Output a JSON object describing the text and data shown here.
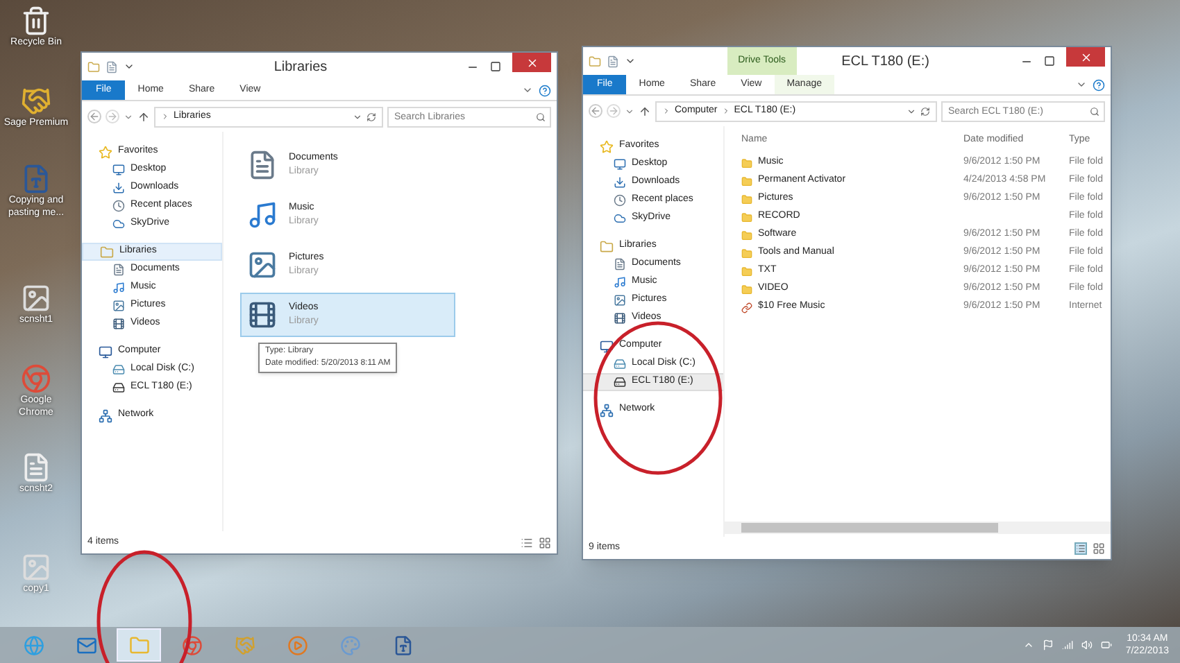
{
  "desktop_icons": [
    {
      "label": "Recycle Bin",
      "kind": "bin"
    },
    {
      "label": "Sage Premium",
      "kind": "app"
    },
    {
      "label": "Copying and pasting me...",
      "kind": "word"
    },
    {
      "label": "scnsht1",
      "kind": "image"
    },
    {
      "label": "Google Chrome",
      "kind": "chrome"
    },
    {
      "label": "scnsht2",
      "kind": "doc"
    },
    {
      "label": "copy1",
      "kind": "image"
    }
  ],
  "windows": [
    {
      "kind": "libraries",
      "title": "Libraries",
      "tabs": [
        {
          "label": "File",
          "kind": "file"
        },
        {
          "label": "Home",
          "kind": "tab"
        },
        {
          "label": "Share",
          "kind": "tab"
        },
        {
          "label": "View",
          "kind": "tab"
        }
      ],
      "address": [
        "Libraries"
      ],
      "search": {
        "placeholder": "Search Libraries"
      },
      "nav": [
        {
          "label": "Favorites",
          "selected": false,
          "children": [
            {
              "label": "Desktop",
              "selected": false
            },
            {
              "label": "Downloads",
              "selected": false
            },
            {
              "label": "Recent places",
              "selected": false
            },
            {
              "label": "SkyDrive",
              "selected": false
            }
          ]
        },
        {
          "label": "Libraries",
          "selected": true,
          "children": [
            {
              "label": "Documents",
              "selected": false
            },
            {
              "label": "Music",
              "selected": false
            },
            {
              "label": "Pictures",
              "selected": false
            },
            {
              "label": "Videos",
              "selected": false
            }
          ]
        },
        {
          "label": "Computer",
          "selected": false,
          "children": [
            {
              "label": "Local Disk (C:)",
              "selected": false
            },
            {
              "label": "ECL T180 (E:)",
              "selected": false
            }
          ]
        },
        {
          "label": "Network",
          "selected": false
        }
      ],
      "tiles": [
        {
          "name": "Documents",
          "subtitle": "Library",
          "selected": false
        },
        {
          "name": "Music",
          "subtitle": "Library",
          "selected": false
        },
        {
          "name": "Pictures",
          "subtitle": "Library",
          "selected": false
        },
        {
          "name": "Videos",
          "subtitle": "Library",
          "selected": true
        }
      ],
      "tooltip": [
        "Type: Library",
        "Date modified: 5/20/2013 8:11 AM"
      ],
      "status": "4 items"
    },
    {
      "kind": "details",
      "title": "ECL T180 (E:)",
      "context_tab": "Drive Tools",
      "tabs": [
        {
          "label": "File",
          "kind": "file"
        },
        {
          "label": "Home",
          "kind": "tab"
        },
        {
          "label": "Share",
          "kind": "tab"
        },
        {
          "label": "View",
          "kind": "tab"
        },
        {
          "label": "Manage",
          "kind": "context"
        }
      ],
      "address": [
        "Computer",
        "ECL T180 (E:)"
      ],
      "search": {
        "placeholder": "Search ECL T180 (E:)"
      },
      "nav": [
        {
          "label": "Favorites",
          "selected": false,
          "children": [
            {
              "label": "Desktop",
              "selected": false
            },
            {
              "label": "Downloads",
              "selected": false
            },
            {
              "label": "Recent places",
              "selected": false
            },
            {
              "label": "SkyDrive",
              "selected": false
            }
          ]
        },
        {
          "label": "Libraries",
          "selected": false,
          "children": [
            {
              "label": "Documents",
              "selected": false
            },
            {
              "label": "Music",
              "selected": false
            },
            {
              "label": "Pictures",
              "selected": false
            },
            {
              "label": "Videos",
              "selected": false
            }
          ]
        },
        {
          "label": "Computer",
          "selected": false,
          "children": [
            {
              "label": "Local Disk (C:)",
              "selected": false
            },
            {
              "label": "ECL T180 (E:)",
              "selected": true
            }
          ]
        },
        {
          "label": "Network",
          "selected": false
        }
      ],
      "columns": [
        "Name",
        "Date modified",
        "Type"
      ],
      "rows": [
        {
          "name": "Music",
          "date": "9/6/2012 1:50 PM",
          "type": "File fold",
          "kind": "folder"
        },
        {
          "name": "Permanent Activator",
          "date": "4/24/2013 4:58 PM",
          "type": "File fold",
          "kind": "folder"
        },
        {
          "name": "Pictures",
          "date": "9/6/2012 1:50 PM",
          "type": "File fold",
          "kind": "folder"
        },
        {
          "name": "RECORD",
          "type": "File fold",
          "kind": "folder"
        },
        {
          "name": "Software",
          "date": "9/6/2012 1:50 PM",
          "type": "File fold",
          "kind": "folder"
        },
        {
          "name": "Tools and Manual",
          "date": "9/6/2012 1:50 PM",
          "type": "File fold",
          "kind": "folder"
        },
        {
          "name": "TXT",
          "date": "9/6/2012 1:50 PM",
          "type": "File fold",
          "kind": "folder"
        },
        {
          "name": "VIDEO",
          "date": "9/6/2012 1:50 PM",
          "type": "File fold",
          "kind": "folder"
        },
        {
          "name": "$10 Free Music",
          "date": "9/6/2012 1:50 PM",
          "type": "Internet",
          "kind": "shortcut"
        }
      ],
      "status": "9 items"
    }
  ],
  "taskbar": {
    "apps": [
      {
        "kind": "ie",
        "selected": false
      },
      {
        "kind": "outlook",
        "selected": false
      },
      {
        "kind": "explorer",
        "selected": true
      },
      {
        "kind": "chrome",
        "selected": false
      },
      {
        "kind": "handshake",
        "selected": false
      },
      {
        "kind": "media",
        "selected": false
      },
      {
        "kind": "paint",
        "selected": false
      },
      {
        "kind": "word",
        "selected": false
      }
    ],
    "time": "10:34 AM",
    "date": "7/22/2013"
  }
}
